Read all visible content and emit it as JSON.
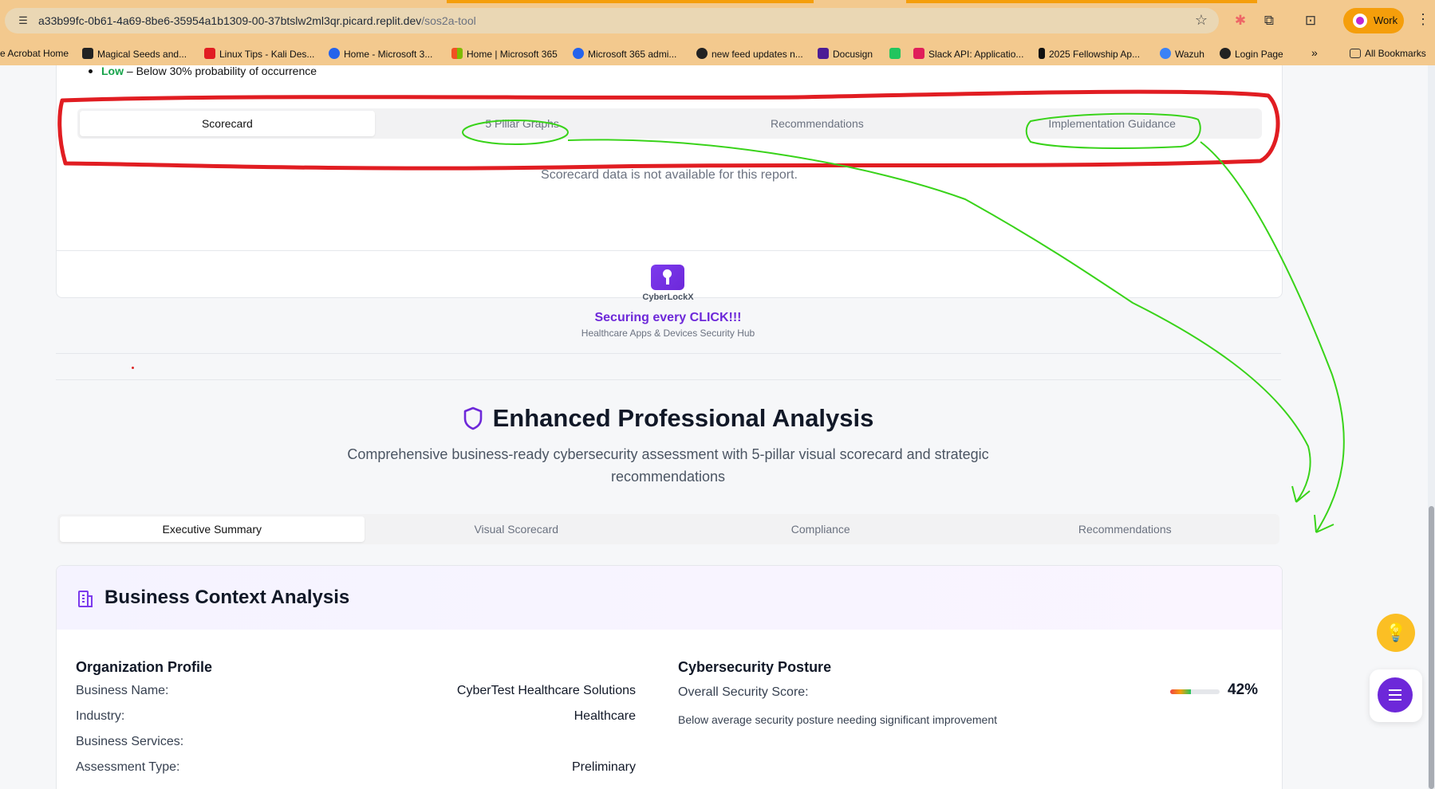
{
  "browser": {
    "url_host": "a33b99fc-0b61-4a69-8be6-35954a1b1309-00-37btslw2ml3qr.picard.replit.dev",
    "url_path": "/sos2a-tool",
    "profile_label": "Work",
    "bookmarks": [
      "e Acrobat Home",
      "Magical Seeds and...",
      "Linux Tips - Kali Des...",
      "Home - Microsoft 3...",
      "Home | Microsoft 365",
      "Microsoft 365 admi...",
      "new feed updates n...",
      "Docusign",
      "Slack API: Applicatio...",
      "2025 Fellowship Ap...",
      "Wazuh",
      "Login Page",
      "All Bookmarks"
    ],
    "overflow_label": "»"
  },
  "risk_legend": {
    "low_label": "Low",
    "low_text": " – Below 30% probability of occurrence"
  },
  "report_tabs": [
    "Scorecard",
    "5 Pillar Graphs",
    "Recommendations",
    "Implementation Guidance"
  ],
  "scorecard_notice": "Scorecard data is not available for this report.",
  "brand": {
    "name": "CyberLockX",
    "tagline": "Securing every CLICK!!!",
    "subtitle": "Healthcare Apps & Devices Security Hub"
  },
  "analysis": {
    "title": "Enhanced Professional Analysis",
    "subtitle": "Comprehensive business-ready cybersecurity assessment with 5-pillar visual scorecard and strategic recommendations",
    "tabs": [
      "Executive Summary",
      "Visual Scorecard",
      "Compliance",
      "Recommendations"
    ]
  },
  "business_context": {
    "title": "Business Context Analysis",
    "org_profile_heading": "Organization Profile",
    "rows": [
      {
        "label": "Business Name:",
        "value": "CyberTest Healthcare Solutions"
      },
      {
        "label": "Industry:",
        "value": "Healthcare"
      },
      {
        "label": "Business Services:",
        "value": ""
      },
      {
        "label": "Assessment Type:",
        "value": "Preliminary"
      }
    ],
    "posture_heading": "Cybersecurity Posture",
    "overall_label": "Overall Security Score:",
    "overall_score": "42%",
    "overall_score_fraction": 0.42,
    "posture_note": "Below average security posture needing significant improvement"
  },
  "colors": {
    "accent": "#6d28d9",
    "low_risk": "#16a34a",
    "annotation_red": "#e11d22",
    "annotation_green": "#39d31a",
    "fab_bulb": "#fbbf24"
  }
}
